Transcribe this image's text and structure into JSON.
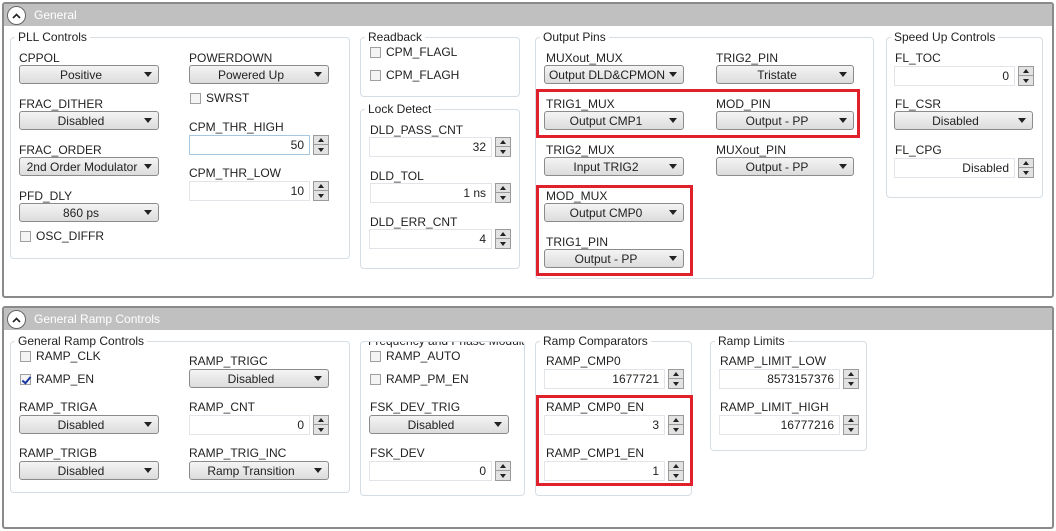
{
  "sections": {
    "general": {
      "title": "General",
      "pll_controls": {
        "title": "PLL Controls",
        "cppol": {
          "label": "CPPOL",
          "value": "Positive"
        },
        "powerdown": {
          "label": "POWERDOWN",
          "value": "Powered Up"
        },
        "swrst": {
          "label": "SWRST",
          "checked": false
        },
        "frac_dither": {
          "label": "FRAC_DITHER",
          "value": "Disabled"
        },
        "cpm_thr_high": {
          "label": "CPM_THR_HIGH",
          "value": "50"
        },
        "frac_order": {
          "label": "FRAC_ORDER",
          "value": "2nd Order Modulator"
        },
        "cpm_thr_low": {
          "label": "CPM_THR_LOW",
          "value": "10"
        },
        "pfd_dly": {
          "label": "PFD_DLY",
          "value": "860 ps"
        },
        "osc_diffr": {
          "label": "OSC_DIFFR",
          "checked": false
        }
      },
      "readback": {
        "title": "Readback",
        "cpm_flagl": {
          "label": "CPM_FLAGL",
          "checked": false
        },
        "cpm_flagh": {
          "label": "CPM_FLAGH",
          "checked": false
        }
      },
      "lock_detect": {
        "title": "Lock Detect",
        "dld_pass_cnt": {
          "label": "DLD_PASS_CNT",
          "value": "32"
        },
        "dld_tol": {
          "label": "DLD_TOL",
          "value": "1 ns"
        },
        "dld_err_cnt": {
          "label": "DLD_ERR_CNT",
          "value": "4"
        }
      },
      "output_pins": {
        "title": "Output Pins",
        "muxout_mux": {
          "label": "MUXout_MUX",
          "value": "Output DLD&CPMON"
        },
        "trig2_pin": {
          "label": "TRIG2_PIN",
          "value": "Tristate"
        },
        "trig1_mux": {
          "label": "TRIG1_MUX",
          "value": "Output CMP1"
        },
        "mod_pin": {
          "label": "MOD_PIN",
          "value": "Output - PP"
        },
        "trig2_mux": {
          "label": "TRIG2_MUX",
          "value": "Input TRIG2"
        },
        "muxout_pin": {
          "label": "MUXout_PIN",
          "value": "Output - PP"
        },
        "mod_mux": {
          "label": "MOD_MUX",
          "value": "Output CMP0"
        },
        "trig1_pin": {
          "label": "TRIG1_PIN",
          "value": "Output - PP"
        }
      },
      "speed_up": {
        "title": "Speed Up Controls",
        "fl_toc": {
          "label": "FL_TOC",
          "value": "0"
        },
        "fl_csr": {
          "label": "FL_CSR",
          "value": "Disabled"
        },
        "fl_cpg": {
          "label": "FL_CPG",
          "value": "Disabled"
        }
      }
    },
    "ramp": {
      "title": "General Ramp Controls",
      "general_ramp": {
        "title": "General Ramp Controls",
        "ramp_clk": {
          "label": "RAMP_CLK",
          "checked": false
        },
        "ramp_en": {
          "label": "RAMP_EN",
          "checked": true
        },
        "ramp_trigc": {
          "label": "RAMP_TRIGC",
          "value": "Disabled"
        },
        "ramp_triga": {
          "label": "RAMP_TRIGA",
          "value": "Disabled"
        },
        "ramp_cnt": {
          "label": "RAMP_CNT",
          "value": "0"
        },
        "ramp_trigb": {
          "label": "RAMP_TRIGB",
          "value": "Disabled"
        },
        "ramp_trig_inc": {
          "label": "RAMP_TRIG_INC",
          "value": "Ramp Transition"
        }
      },
      "freq_phase": {
        "title": "Frequency and Phase Modula",
        "ramp_auto": {
          "label": "RAMP_AUTO",
          "checked": false
        },
        "ramp_pm_en": {
          "label": "RAMP_PM_EN",
          "checked": false
        },
        "fsk_dev_trig": {
          "label": "FSK_DEV_TRIG",
          "value": "Disabled"
        },
        "fsk_dev": {
          "label": "FSK_DEV",
          "value": "0"
        }
      },
      "ramp_comparators": {
        "title": "Ramp Comparators",
        "ramp_cmp0": {
          "label": "RAMP_CMP0",
          "value": "1677721"
        },
        "ramp_cmp0_en": {
          "label": "RAMP_CMP0_EN",
          "value": "3"
        },
        "ramp_cmp1_en": {
          "label": "RAMP_CMP1_EN",
          "value": "1"
        }
      },
      "ramp_limits": {
        "title": "Ramp Limits",
        "ramp_limit_low": {
          "label": "RAMP_LIMIT_LOW",
          "value": "8573157376"
        },
        "ramp_limit_high": {
          "label": "RAMP_LIMIT_HIGH",
          "value": "16777216"
        }
      }
    }
  },
  "colors": {
    "highlight": "#e0202b",
    "header": "#c0c0c0",
    "check": "#1a3aa0"
  }
}
